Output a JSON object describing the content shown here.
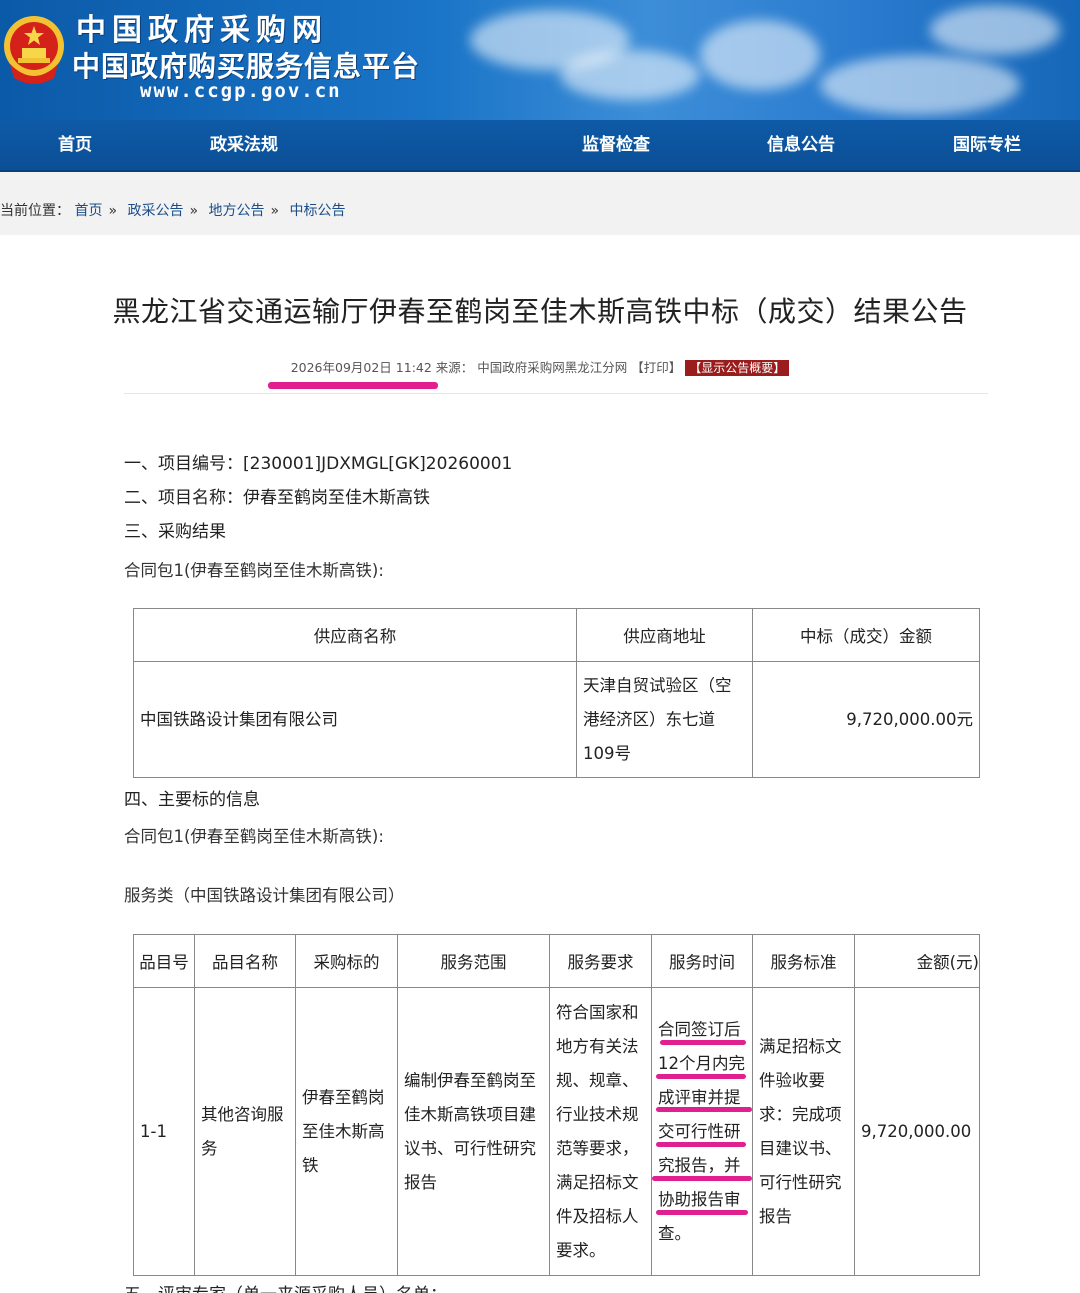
{
  "header": {
    "site_name": "中国政府采购网",
    "platform_name": "中国政府购买服务信息平台",
    "url": "www.ccgp.gov.cn",
    "logo_icon": "national-emblem-icon"
  },
  "nav": {
    "items": [
      "首页",
      "政采法规",
      "监督检查",
      "信息公告",
      "国际专栏"
    ]
  },
  "breadcrumb": {
    "prefix": "当前位置：",
    "items": [
      "首页",
      "政采公告",
      "地方公告",
      "中标公告"
    ],
    "separator": "»"
  },
  "article": {
    "title": "黑龙江省交通运输厅伊春至鹤岗至佳木斯高铁中标（成交）结果公告",
    "datetime": "2026年09月02日 11:42",
    "source_label": "来源：",
    "source": "中国政府采购网黑龙江分网",
    "print_label": "【打印】",
    "summary_button": "【显示公告概要】"
  },
  "sections": {
    "project_no": "一、项目编号：[230001]JDXMGL[GK]20260001",
    "project_name": "二、项目名称：伊春至鹤岗至佳木斯高铁",
    "result_heading": "三、采购结果",
    "package_1": "合同包1(伊春至鹤岗至佳木斯高铁):",
    "subject_heading": "四、主要标的信息",
    "package_1b": "合同包1(伊春至鹤岗至佳木斯高铁):",
    "service_type": "服务类（中国铁路设计集团有限公司）",
    "experts_heading": "五、评审专家（单一来源采购人员）名单："
  },
  "result_table": {
    "headers": [
      "供应商名称",
      "供应商地址",
      "中标（成交）金额"
    ],
    "rows": [
      [
        "中国铁路设计集团有限公司",
        "天津自贸试验区（空港经济区）东七道109号",
        "9,720,000.00元"
      ]
    ]
  },
  "subject_table": {
    "headers": [
      "品目号",
      "品目名称",
      "采购标的",
      "服务范围",
      "服务要求",
      "服务时间",
      "服务标准",
      "金额(元)"
    ],
    "rows": [
      [
        "1-1",
        "其他咨询服务",
        "伊春至鹤岗至佳木斯高铁",
        "编制伊春至鹤岗至佳木斯高铁项目建议书、可行性研究报告",
        "符合国家和地方有关法规、规章、行业技术规范等要求，满足招标文件及招标人要求。",
        "合同签订后12个月内完成评审并提交可行性研究报告，并协助报告审查。",
        "满足招标文件验收要求：完成项目建议书、可行性研究报告",
        "9,720,000.00"
      ]
    ]
  },
  "colors": {
    "banner": "#1a74c7",
    "nav": "#0e5aa7",
    "highlight": "#e0208f",
    "summary_button": "#9b1c1c"
  }
}
